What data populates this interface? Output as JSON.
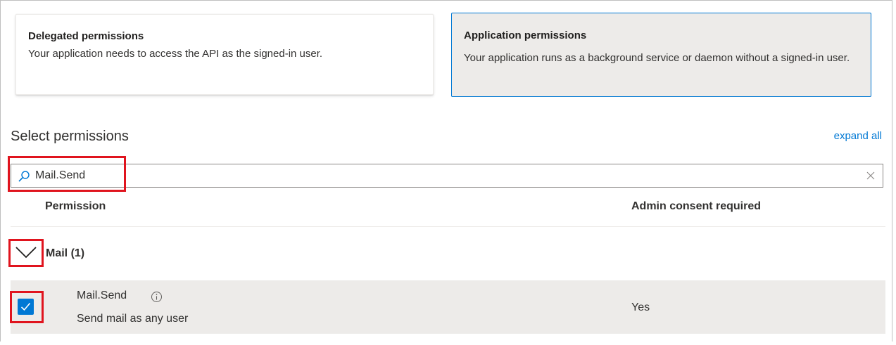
{
  "permission_types": {
    "delegated": {
      "title": "Delegated permissions",
      "description": "Your application needs to access the API as the signed-in user."
    },
    "application": {
      "title": "Application permissions",
      "description": "Your application runs as a background service or daemon without a signed-in user.",
      "selected": true
    }
  },
  "select_permissions": {
    "title": "Select permissions",
    "expand_all_label": "expand all"
  },
  "search": {
    "value": "Mail.Send",
    "icon": "search-icon",
    "clear_icon": "close-icon"
  },
  "table": {
    "columns": [
      "Permission",
      "Admin consent required"
    ],
    "groups": [
      {
        "label": "Mail (1)",
        "expanded": true,
        "items": [
          {
            "name": "Mail.Send",
            "description": "Send mail as any user",
            "admin_consent": "Yes",
            "checked": true
          }
        ]
      }
    ]
  },
  "colors": {
    "accent": "#0078d4",
    "highlight": "#e0141e",
    "selected_background": "#edebe9"
  }
}
